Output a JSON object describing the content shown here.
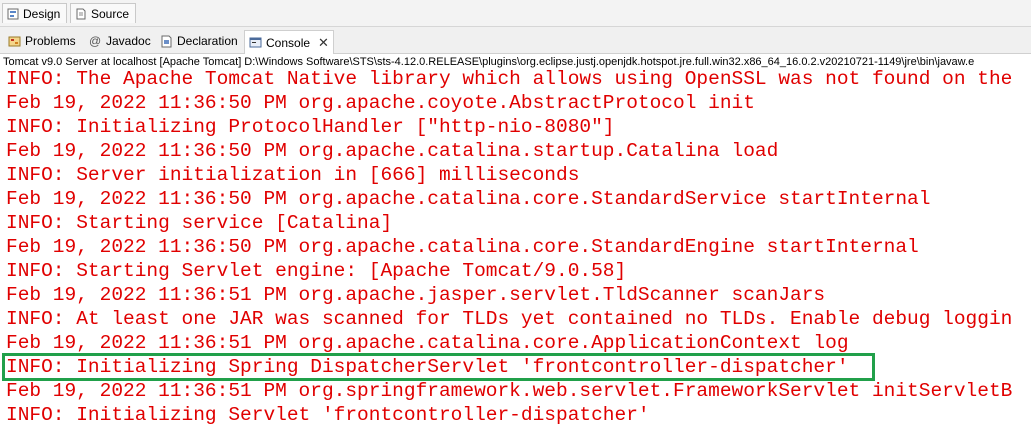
{
  "editor_tabs": [
    {
      "label": "Design",
      "icon": "design-icon"
    },
    {
      "label": "Source",
      "icon": "source-icon"
    }
  ],
  "view_tabs": [
    {
      "label": "Problems",
      "icon": "problems-icon"
    },
    {
      "label": "Javadoc",
      "icon": "javadoc-icon"
    },
    {
      "label": "Declaration",
      "icon": "declaration-icon"
    },
    {
      "label": "Console",
      "icon": "console-icon",
      "active": true
    }
  ],
  "console": {
    "process": "Tomcat v9.0 Server at localhost [Apache Tomcat] D:\\Windows Software\\STS\\sts-4.12.0.RELEASE\\plugins\\org.eclipse.justj.openjdk.hotspot.jre.full.win32.x86_64_16.0.2.v20210721-1149\\jre\\bin\\javaw.e",
    "lines": [
      "INFO: The Apache Tomcat Native library which allows using OpenSSL was not found on the",
      "Feb 19, 2022 11:36:50 PM org.apache.coyote.AbstractProtocol init",
      "INFO: Initializing ProtocolHandler [\"http-nio-8080\"]",
      "Feb 19, 2022 11:36:50 PM org.apache.catalina.startup.Catalina load",
      "INFO: Server initialization in [666] milliseconds",
      "Feb 19, 2022 11:36:50 PM org.apache.catalina.core.StandardService startInternal",
      "INFO: Starting service [Catalina]",
      "Feb 19, 2022 11:36:50 PM org.apache.catalina.core.StandardEngine startInternal",
      "INFO: Starting Servlet engine: [Apache Tomcat/9.0.58]",
      "Feb 19, 2022 11:36:51 PM org.apache.jasper.servlet.TldScanner scanJars",
      "INFO: At least one JAR was scanned for TLDs yet contained no TLDs. Enable debug loggin",
      "Feb 19, 2022 11:36:51 PM org.apache.catalina.core.ApplicationContext log",
      "INFO: Initializing Spring DispatcherServlet 'frontcontroller-dispatcher'",
      "Feb 19, 2022 11:36:51 PM org.springframework.web.servlet.FrameworkServlet initServletB",
      "INFO: Initializing Servlet 'frontcontroller-dispatcher'"
    ],
    "text_color": "#e00000",
    "highlight_color": "#21a04a"
  }
}
